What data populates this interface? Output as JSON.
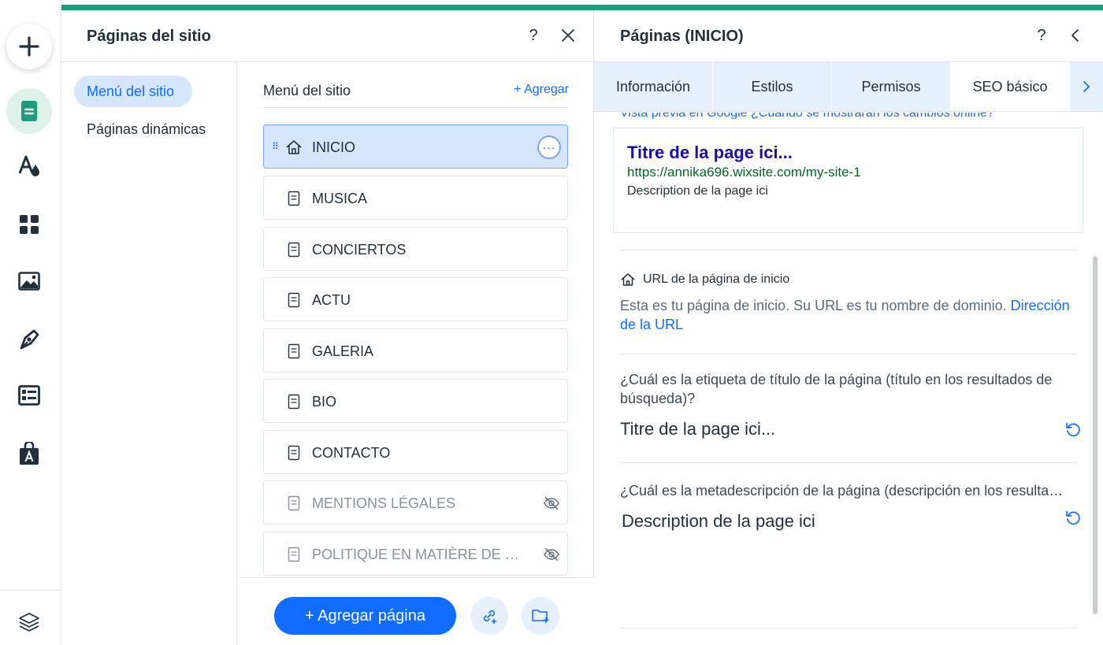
{
  "rail": {
    "icons": [
      "add-icon",
      "pages-icon",
      "design-icon",
      "apps-icon",
      "media-icon",
      "blog-icon",
      "cms-icon",
      "business-icon",
      "layers-icon"
    ]
  },
  "pages_panel": {
    "title": "Páginas del sitio",
    "help": "?",
    "close": "✕",
    "nav": {
      "active": "Menú del sitio",
      "dynamic": "Páginas dinámicas"
    },
    "menu_title": "Menú del sitio",
    "add_link": "+ Agregar",
    "pages": [
      {
        "label": "INICIO",
        "home": true,
        "selected": true,
        "hidden": false
      },
      {
        "label": "MUSICA",
        "home": false,
        "selected": false,
        "hidden": false
      },
      {
        "label": "CONCIERTOS",
        "home": false,
        "selected": false,
        "hidden": false
      },
      {
        "label": "ACTU",
        "home": false,
        "selected": false,
        "hidden": false
      },
      {
        "label": "GALERIA",
        "home": false,
        "selected": false,
        "hidden": false
      },
      {
        "label": "BIO",
        "home": false,
        "selected": false,
        "hidden": false
      },
      {
        "label": "CONTACTO",
        "home": false,
        "selected": false,
        "hidden": false
      },
      {
        "label": "MENTIONS LÉGALES",
        "home": false,
        "selected": false,
        "hidden": true
      },
      {
        "label": "POLITIQUE EN MATIÈRE DE …",
        "home": false,
        "selected": false,
        "hidden": true
      }
    ],
    "dots": "···",
    "add_page_button": "+ Agregar página"
  },
  "settings_panel": {
    "title": "Páginas (INICIO)",
    "help": "?",
    "back": "‹",
    "tabs": [
      "Información",
      "Estilos",
      "Permisos",
      "SEO básico"
    ],
    "active_tab": "SEO básico",
    "cut_text": "Vista previa en Google ¿Cuándo se mostrarán los cambios online?",
    "preview": {
      "title": "Titre de la page ici...",
      "url": "https://annika696.wixsite.com/my-site-1",
      "description": "Description de la page ici"
    },
    "url_section": {
      "heading": "URL de la página de inicio",
      "body": "Esta es tu página de inicio. Su URL es tu nombre de dominio.",
      "link": "Dirección de la URL"
    },
    "title_question": "¿Cuál es la etiqueta de título de la página (título en los resultados de búsqueda)?",
    "title_value": "Titre de la page ici...",
    "meta_question": "¿Cuál es la metadescripción de la página (descripción en los resulta…",
    "meta_value": "Description de la page ici"
  },
  "colors": {
    "accent": "#116dff",
    "green_bar": "#1c9c7a",
    "selected_row": "#d6e6fe",
    "google_title": "#1a0dab",
    "google_url": "#006621"
  }
}
